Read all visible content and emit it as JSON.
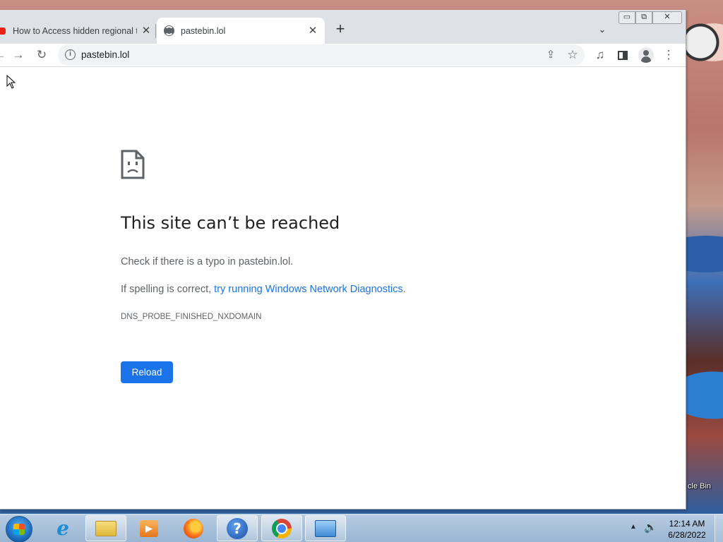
{
  "browser": {
    "tabs": [
      {
        "title": "How to Access hidden regional th",
        "close": "✕"
      },
      {
        "title": "pastebin.lol",
        "close": "✕"
      }
    ],
    "new_tab": "+",
    "tab_search": "⌄",
    "window_controls": {
      "minimize": "▭",
      "maximize": "⧉",
      "close": "✕"
    },
    "nav": {
      "back": "←",
      "forward": "→",
      "reload": "↻"
    },
    "omnibox": {
      "info": "i",
      "url": "pastebin.lol"
    },
    "actions": {
      "share": "⇪",
      "bookmark": "☆",
      "media": "♫",
      "menu": "⋮"
    }
  },
  "error_page": {
    "title": "This site can’t be reached",
    "line1": "Check if there is a typo in pastebin.lol.",
    "line2_prefix": "If spelling is correct, ",
    "line2_link": "try running Windows Network Diagnostics",
    "line2_suffix": ".",
    "error_code": "DNS_PROBE_FINISHED_NXDOMAIN",
    "reload_label": "Reload"
  },
  "desktop": {
    "recycle_bin_label": "cle Bin"
  },
  "taskbar": {
    "time": "12:14 AM",
    "date": "6/28/2022",
    "help_glyph": "?",
    "ie_glyph": "e",
    "media_glyph": "▶",
    "tray_arrow": "▲",
    "volume_glyph": "🔊"
  },
  "colors": {
    "link": "#1a73e8",
    "reload_button": "#1a73e8",
    "tabstrip": "#dee1e6"
  }
}
